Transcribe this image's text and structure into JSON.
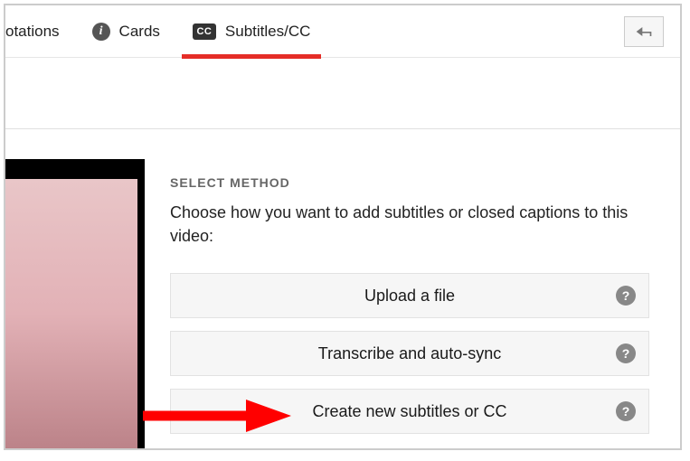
{
  "tabs": {
    "annotations": {
      "label": "otations"
    },
    "cards": {
      "label": "Cards",
      "icon_letter": "i"
    },
    "subtitles": {
      "label": "Subtitles/CC",
      "cc_badge": "CC"
    }
  },
  "section": {
    "heading": "SELECT METHOD",
    "description": "Choose how you want to add subtitles or closed captions to this video:"
  },
  "methods": [
    {
      "label": "Upload a file"
    },
    {
      "label": "Transcribe and auto-sync"
    },
    {
      "label": "Create new subtitles or CC"
    }
  ],
  "help_glyph": "?",
  "colors": {
    "accent": "#e52d27",
    "arrow": "#ff0000"
  }
}
